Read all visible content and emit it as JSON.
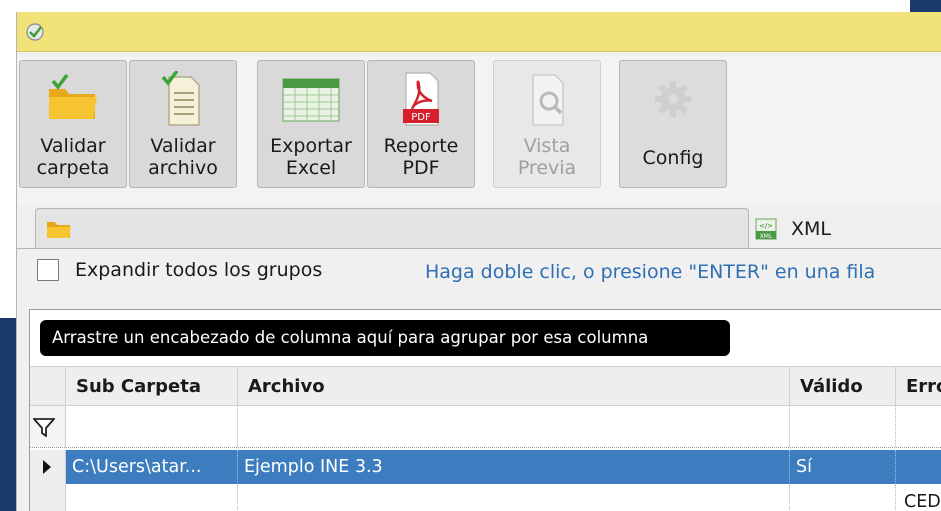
{
  "toolbar": {
    "validar_carpeta": "Validar\ncarpeta",
    "validar_archivo": "Validar\narchivo",
    "exportar_excel": "Exportar\nExcel",
    "reporte_pdf": "Reporte\nPDF",
    "vista_previa": "Vista\nPrevia",
    "config": "Config",
    "pdf_badge": "PDF"
  },
  "tabs": {
    "folder_icon": "folder-icon",
    "xml_label": "XML",
    "xml_icon_text": "XML"
  },
  "panel": {
    "expand_label": "Expandir todos los grupos",
    "hint": "Haga doble clic, o presione \"ENTER\" en una fila"
  },
  "grid": {
    "group_bar": "Arrastre un encabezado de columna aquí para agrupar por esa columna",
    "columns": [
      "Sub Carpeta",
      "Archivo",
      "Válido",
      "Erro"
    ],
    "rows": [
      {
        "sub_carpeta": "C:\\Users\\atar...",
        "archivo": "Ejemplo INE 3.3",
        "valido": "Sí",
        "error": ""
      },
      {
        "sub_carpeta": "",
        "archivo": "",
        "valido": "",
        "error": "CED"
      }
    ]
  },
  "colors": {
    "titlebar": "#f2e27a",
    "selection": "#3d7dbf",
    "hint": "#2f6fb4"
  }
}
